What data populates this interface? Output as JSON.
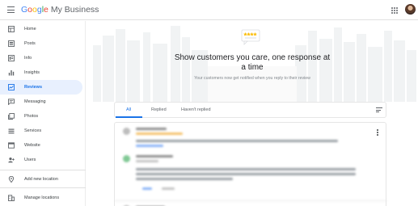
{
  "header": {
    "brand_letters": [
      "G",
      "o",
      "o",
      "g",
      "l",
      "e"
    ],
    "brand_rest": "My Business"
  },
  "sidebar": {
    "items": [
      {
        "label": "Home",
        "icon": "home-icon"
      },
      {
        "label": "Posts",
        "icon": "posts-icon"
      },
      {
        "label": "Info",
        "icon": "info-icon"
      },
      {
        "label": "Insights",
        "icon": "insights-icon"
      },
      {
        "label": "Reviews",
        "icon": "reviews-icon",
        "active": true
      },
      {
        "label": "Messaging",
        "icon": "messaging-icon"
      },
      {
        "label": "Photos",
        "icon": "photos-icon"
      },
      {
        "label": "Services",
        "icon": "services-icon"
      },
      {
        "label": "Website",
        "icon": "website-icon"
      },
      {
        "label": "Users",
        "icon": "users-icon"
      }
    ],
    "add_location": {
      "label": "Add new location",
      "icon": "location-pin-icon"
    },
    "manage_locations": {
      "label": "Manage locations",
      "icon": "building-icon"
    }
  },
  "hero": {
    "title": "Show customers you care, one response at a time",
    "subtitle": "Your customers now get notified when you reply to their review"
  },
  "tabs": [
    {
      "label": "All",
      "active": true
    },
    {
      "label": "Replied"
    },
    {
      "label": "Haven't replied"
    }
  ],
  "colors": {
    "accent": "#1a73e8",
    "active_bg": "#e8f0fe",
    "star": "#fbbc04"
  }
}
